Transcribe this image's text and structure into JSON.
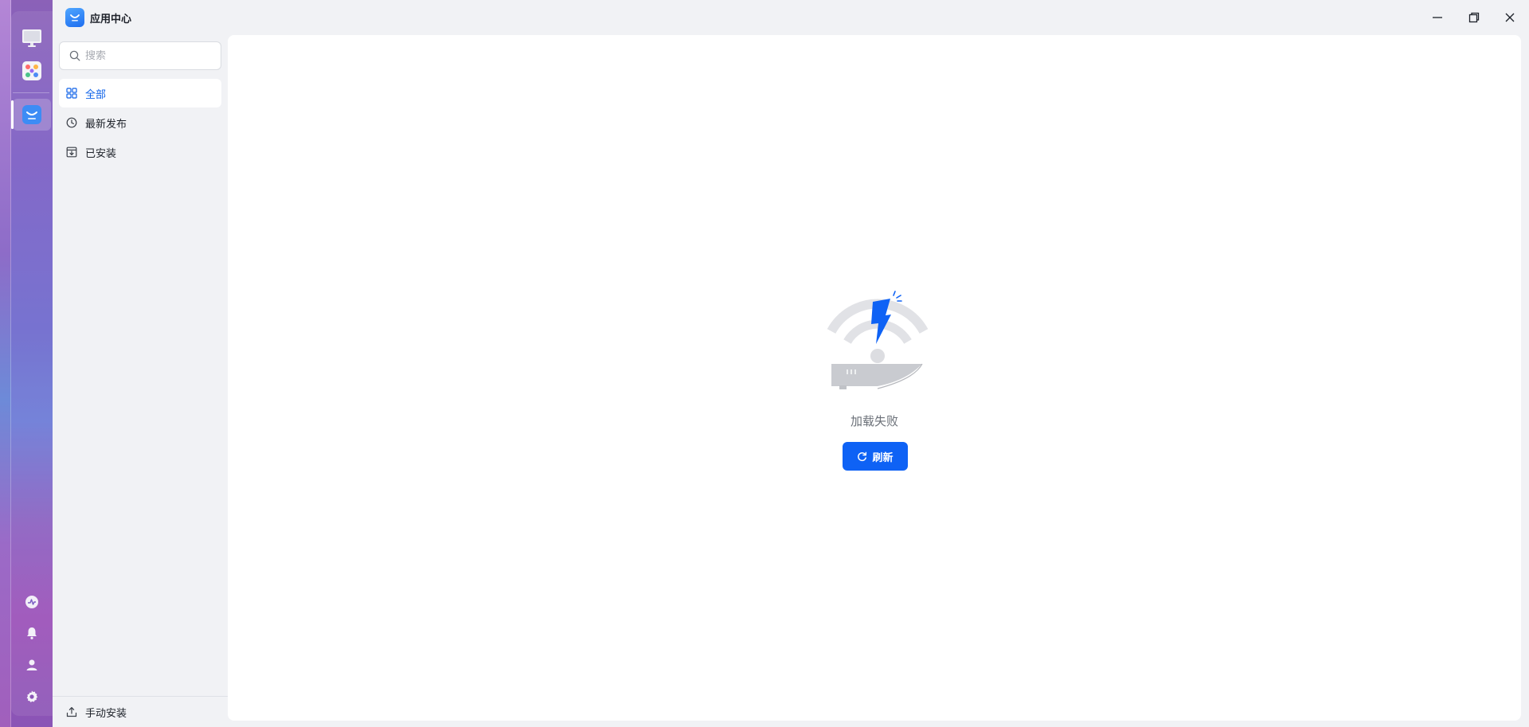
{
  "window": {
    "title": "应用中心"
  },
  "search": {
    "placeholder": "搜索"
  },
  "sidebar": {
    "items": [
      {
        "label": "全部",
        "icon": "grid-icon",
        "active": true
      },
      {
        "label": "最新发布",
        "icon": "clock-icon",
        "active": false
      },
      {
        "label": "已安装",
        "icon": "archive-icon",
        "active": false
      }
    ],
    "footer_label": "手动安装"
  },
  "main": {
    "error_text": "加载失败",
    "refresh_label": "刷新"
  },
  "colors": {
    "accent": "#0e62f5",
    "active_text": "#0e62e8"
  }
}
